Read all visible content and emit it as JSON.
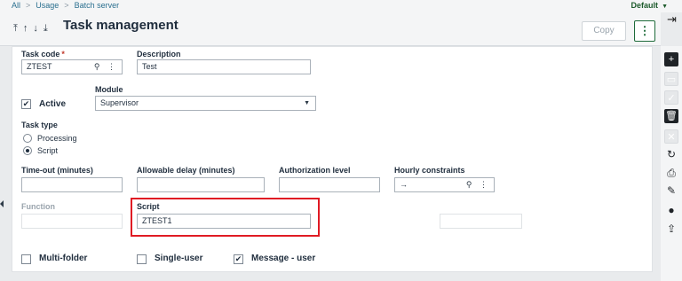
{
  "breadcrumb": {
    "items": [
      "All",
      "Usage",
      "Batch server"
    ],
    "separator": ">"
  },
  "top_right": {
    "folder_label": "Default"
  },
  "header": {
    "title": "Task management",
    "copy_label": "Copy",
    "more_glyph": "⋮"
  },
  "form": {
    "task_code": {
      "label": "Task code",
      "required_mark": "*",
      "value": "ZTEST"
    },
    "description": {
      "label": "Description",
      "value": "Test"
    },
    "module": {
      "label": "Module",
      "value": "Supervisor"
    },
    "active": {
      "label": "Active",
      "checked": true
    },
    "task_type": {
      "label": "Task type",
      "options": [
        "Processing",
        "Script"
      ],
      "selected": "Script"
    },
    "timeout": {
      "label": "Time-out (minutes)",
      "value": ""
    },
    "allowable_delay": {
      "label": "Allowable delay (minutes)",
      "value": ""
    },
    "authorization_level": {
      "label": "Authorization level",
      "value": ""
    },
    "hourly_constraints": {
      "label": "Hourly constraints",
      "value": "→"
    },
    "function": {
      "label": "Function",
      "value": ""
    },
    "script": {
      "label": "Script",
      "value": "ZTEST1"
    },
    "multi_folder": {
      "label": "Multi-folder",
      "checked": false
    },
    "single_user": {
      "label": "Single-user",
      "checked": false
    },
    "message_user": {
      "label": "Message - user",
      "checked": true
    }
  },
  "icons": {
    "nav": [
      "first-icon",
      "previous-icon",
      "next-icon",
      "last-icon"
    ],
    "side_toolbar": [
      "new-icon",
      "save-icon",
      "validate-icon",
      "delete-icon",
      "cancel-icon",
      "refresh-icon",
      "print-icon",
      "attachment-icon",
      "comment-icon",
      "export-icon"
    ]
  },
  "colors": {
    "accent_green": "#1e6b3a",
    "highlight_red": "#e01b24",
    "link_blue": "#2a6f8f"
  }
}
